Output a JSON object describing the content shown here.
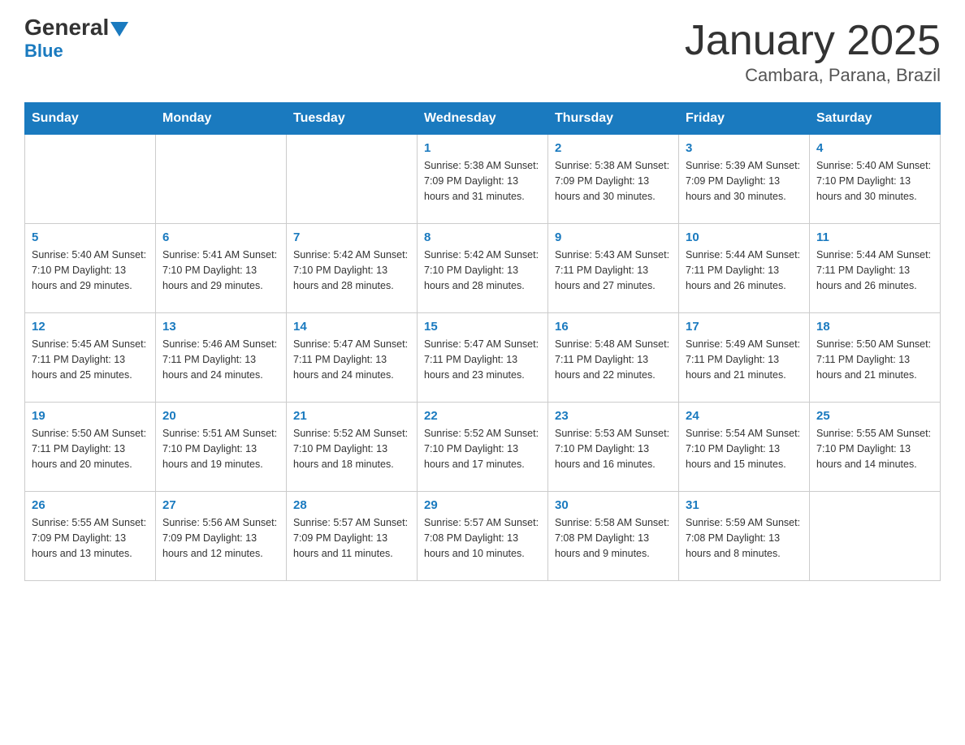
{
  "logo": {
    "part1": "General",
    "part2": "Blue"
  },
  "title": "January 2025",
  "subtitle": "Cambara, Parana, Brazil",
  "days_of_week": [
    "Sunday",
    "Monday",
    "Tuesday",
    "Wednesday",
    "Thursday",
    "Friday",
    "Saturday"
  ],
  "weeks": [
    [
      {
        "day": "",
        "info": ""
      },
      {
        "day": "",
        "info": ""
      },
      {
        "day": "",
        "info": ""
      },
      {
        "day": "1",
        "info": "Sunrise: 5:38 AM\nSunset: 7:09 PM\nDaylight: 13 hours\nand 31 minutes."
      },
      {
        "day": "2",
        "info": "Sunrise: 5:38 AM\nSunset: 7:09 PM\nDaylight: 13 hours\nand 30 minutes."
      },
      {
        "day": "3",
        "info": "Sunrise: 5:39 AM\nSunset: 7:09 PM\nDaylight: 13 hours\nand 30 minutes."
      },
      {
        "day": "4",
        "info": "Sunrise: 5:40 AM\nSunset: 7:10 PM\nDaylight: 13 hours\nand 30 minutes."
      }
    ],
    [
      {
        "day": "5",
        "info": "Sunrise: 5:40 AM\nSunset: 7:10 PM\nDaylight: 13 hours\nand 29 minutes."
      },
      {
        "day": "6",
        "info": "Sunrise: 5:41 AM\nSunset: 7:10 PM\nDaylight: 13 hours\nand 29 minutes."
      },
      {
        "day": "7",
        "info": "Sunrise: 5:42 AM\nSunset: 7:10 PM\nDaylight: 13 hours\nand 28 minutes."
      },
      {
        "day": "8",
        "info": "Sunrise: 5:42 AM\nSunset: 7:10 PM\nDaylight: 13 hours\nand 28 minutes."
      },
      {
        "day": "9",
        "info": "Sunrise: 5:43 AM\nSunset: 7:11 PM\nDaylight: 13 hours\nand 27 minutes."
      },
      {
        "day": "10",
        "info": "Sunrise: 5:44 AM\nSunset: 7:11 PM\nDaylight: 13 hours\nand 26 minutes."
      },
      {
        "day": "11",
        "info": "Sunrise: 5:44 AM\nSunset: 7:11 PM\nDaylight: 13 hours\nand 26 minutes."
      }
    ],
    [
      {
        "day": "12",
        "info": "Sunrise: 5:45 AM\nSunset: 7:11 PM\nDaylight: 13 hours\nand 25 minutes."
      },
      {
        "day": "13",
        "info": "Sunrise: 5:46 AM\nSunset: 7:11 PM\nDaylight: 13 hours\nand 24 minutes."
      },
      {
        "day": "14",
        "info": "Sunrise: 5:47 AM\nSunset: 7:11 PM\nDaylight: 13 hours\nand 24 minutes."
      },
      {
        "day": "15",
        "info": "Sunrise: 5:47 AM\nSunset: 7:11 PM\nDaylight: 13 hours\nand 23 minutes."
      },
      {
        "day": "16",
        "info": "Sunrise: 5:48 AM\nSunset: 7:11 PM\nDaylight: 13 hours\nand 22 minutes."
      },
      {
        "day": "17",
        "info": "Sunrise: 5:49 AM\nSunset: 7:11 PM\nDaylight: 13 hours\nand 21 minutes."
      },
      {
        "day": "18",
        "info": "Sunrise: 5:50 AM\nSunset: 7:11 PM\nDaylight: 13 hours\nand 21 minutes."
      }
    ],
    [
      {
        "day": "19",
        "info": "Sunrise: 5:50 AM\nSunset: 7:11 PM\nDaylight: 13 hours\nand 20 minutes."
      },
      {
        "day": "20",
        "info": "Sunrise: 5:51 AM\nSunset: 7:10 PM\nDaylight: 13 hours\nand 19 minutes."
      },
      {
        "day": "21",
        "info": "Sunrise: 5:52 AM\nSunset: 7:10 PM\nDaylight: 13 hours\nand 18 minutes."
      },
      {
        "day": "22",
        "info": "Sunrise: 5:52 AM\nSunset: 7:10 PM\nDaylight: 13 hours\nand 17 minutes."
      },
      {
        "day": "23",
        "info": "Sunrise: 5:53 AM\nSunset: 7:10 PM\nDaylight: 13 hours\nand 16 minutes."
      },
      {
        "day": "24",
        "info": "Sunrise: 5:54 AM\nSunset: 7:10 PM\nDaylight: 13 hours\nand 15 minutes."
      },
      {
        "day": "25",
        "info": "Sunrise: 5:55 AM\nSunset: 7:10 PM\nDaylight: 13 hours\nand 14 minutes."
      }
    ],
    [
      {
        "day": "26",
        "info": "Sunrise: 5:55 AM\nSunset: 7:09 PM\nDaylight: 13 hours\nand 13 minutes."
      },
      {
        "day": "27",
        "info": "Sunrise: 5:56 AM\nSunset: 7:09 PM\nDaylight: 13 hours\nand 12 minutes."
      },
      {
        "day": "28",
        "info": "Sunrise: 5:57 AM\nSunset: 7:09 PM\nDaylight: 13 hours\nand 11 minutes."
      },
      {
        "day": "29",
        "info": "Sunrise: 5:57 AM\nSunset: 7:08 PM\nDaylight: 13 hours\nand 10 minutes."
      },
      {
        "day": "30",
        "info": "Sunrise: 5:58 AM\nSunset: 7:08 PM\nDaylight: 13 hours\nand 9 minutes."
      },
      {
        "day": "31",
        "info": "Sunrise: 5:59 AM\nSunset: 7:08 PM\nDaylight: 13 hours\nand 8 minutes."
      },
      {
        "day": "",
        "info": ""
      }
    ]
  ]
}
